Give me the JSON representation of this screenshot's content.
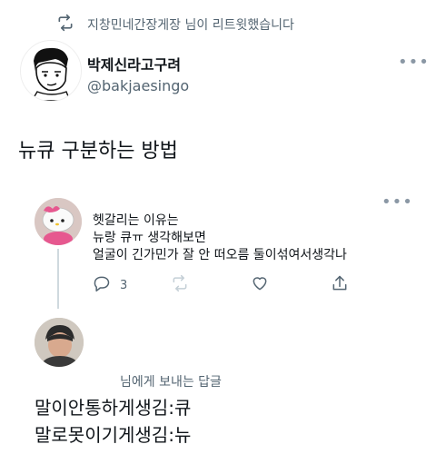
{
  "retweet": {
    "text": "지창민네간장게장 님이 리트윗했습니다",
    "icon": "retweet-icon"
  },
  "main_tweet": {
    "author_name": "박제신라고구려",
    "author_handle": "@bakjaesingo",
    "more_icon": "more-icon",
    "body": "뉴큐 구분하는 방법"
  },
  "quoted_tweet": {
    "lines": [
      "헷갈리는 이유는",
      "뉴랑 큐ㅠ 생각해보면",
      "얼굴이 긴가민가 잘 안 떠오름 둘이섞여서생각나"
    ],
    "reply_count": "3",
    "more_icon": "more-icon"
  },
  "reply": {
    "recipient_text": "님에게 보내는 답글",
    "lines": [
      "말이안통하게생김:큐",
      "말로못이기게생김:뉴"
    ]
  },
  "colors": {
    "text": "#0f1419",
    "secondary": "#536471",
    "border": "#cfd9de"
  }
}
